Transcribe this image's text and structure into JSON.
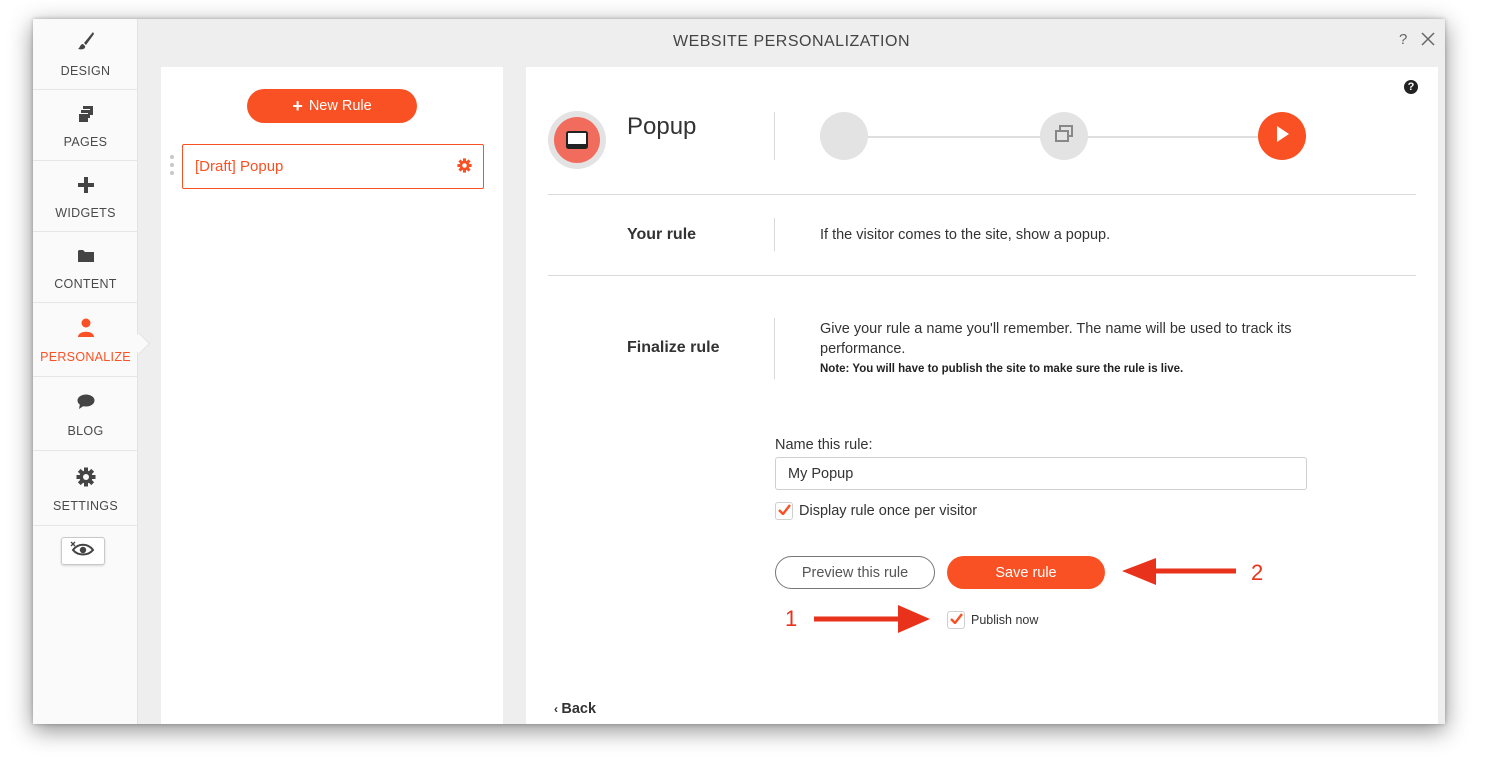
{
  "window": {
    "title": "WEBSITE PERSONALIZATION",
    "help": "?"
  },
  "sidebar": {
    "items": [
      {
        "label": "DESIGN",
        "icon": "brush-icon"
      },
      {
        "label": "PAGES",
        "icon": "pages-icon"
      },
      {
        "label": "WIDGETS",
        "icon": "plus-icon"
      },
      {
        "label": "CONTENT",
        "icon": "folder-icon"
      },
      {
        "label": "PERSONALIZE",
        "icon": "person-icon",
        "active": true
      },
      {
        "label": "BLOG",
        "icon": "chat-bubble-icon"
      },
      {
        "label": "SETTINGS",
        "icon": "gear-icon"
      }
    ],
    "preview_icon": "eye-preview-icon"
  },
  "rules": {
    "new_rule_label": "New Rule",
    "items": [
      {
        "label": "[Draft] Popup"
      }
    ]
  },
  "main": {
    "title": "Popup",
    "steps": [
      {
        "icon": "empty-step-icon",
        "active": false
      },
      {
        "icon": "popup-window-icon",
        "active": false
      },
      {
        "icon": "play-icon",
        "active": true
      }
    ],
    "your_rule": {
      "label": "Your rule",
      "description": "If the visitor comes to the site, show a popup."
    },
    "finalize": {
      "label": "Finalize rule",
      "description": "Give your rule a name you'll remember. The name will be used to track its performance.",
      "note": "Note: You will have to publish the site to make sure the rule is live."
    },
    "form": {
      "name_label": "Name this rule:",
      "name_value": "My Popup",
      "display_once_label": "Display rule once per visitor",
      "display_once_checked": true,
      "preview_label": "Preview this rule",
      "save_label": "Save rule",
      "publish_label": "Publish now",
      "publish_checked": true
    },
    "back_label": "Back"
  },
  "annotations": {
    "one": "1",
    "two": "2"
  },
  "colors": {
    "accent": "#fa5124",
    "annotation": "#e8321c"
  }
}
